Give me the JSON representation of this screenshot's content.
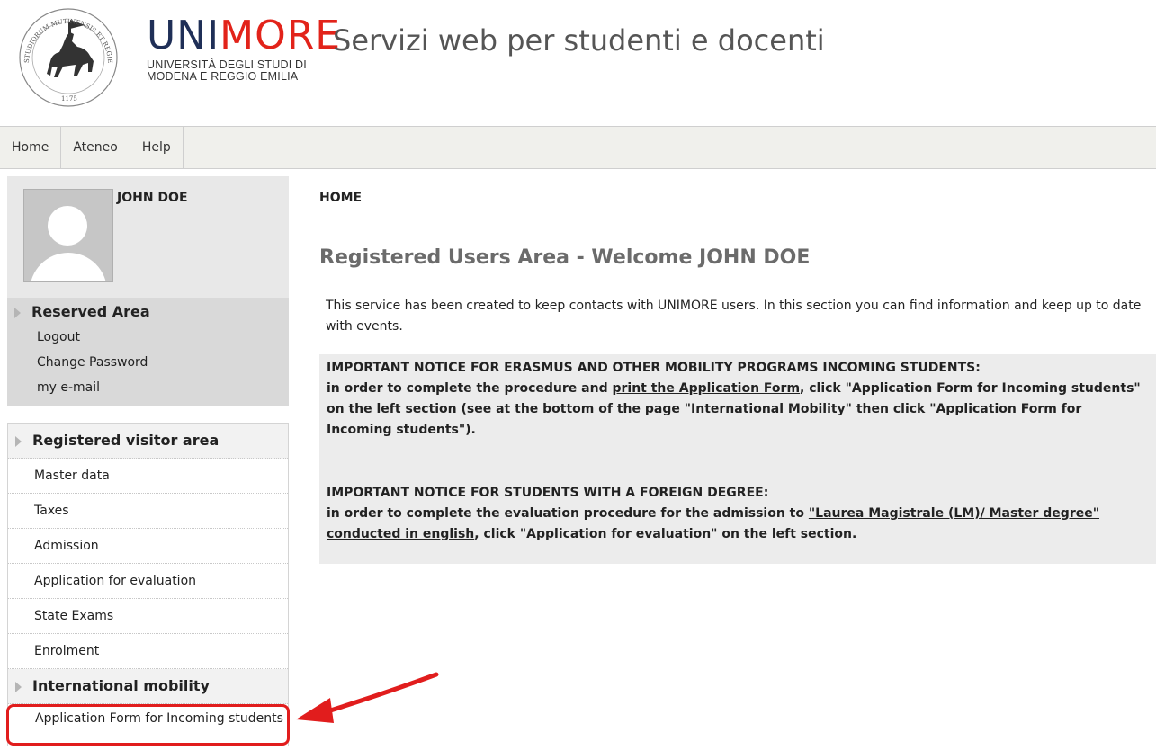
{
  "header": {
    "brand_uni": "UNI",
    "brand_more": "MORE",
    "brand_sub_line1": "UNIVERSITÀ DEGLI STUDI DI",
    "brand_sub_line2": "MODENA E REGGIO EMILIA",
    "site_title": "Servizi web per studenti e docenti",
    "seal_text": "STUDIORUM MUTINENSIS ET REGIENSIS UNIVERSITAS",
    "seal_year": "1175"
  },
  "nav": {
    "items": [
      {
        "label": "Home"
      },
      {
        "label": "Ateneo"
      },
      {
        "label": "Help"
      }
    ]
  },
  "user": {
    "name": "JOHN DOE"
  },
  "reserved": {
    "title": "Reserved Area",
    "links": [
      "Logout",
      "Change Password",
      "my e-mail"
    ]
  },
  "menu": {
    "registered_title": "Registered visitor area",
    "registered_items": [
      "Master data",
      "Taxes",
      "Admission",
      "Application for evaluation",
      "State Exams",
      "Enrolment"
    ],
    "mobility_title": "International mobility",
    "mobility_items": [
      "Application Form for Incoming students"
    ]
  },
  "main": {
    "breadcrumb": "HOME",
    "title": "Registered Users Area - Welcome JOHN DOE",
    "intro": "This service has been created to keep contacts with UNIMORE users. In this section you can find information and keep up to date with events.",
    "notice1_heading": "IMPORTANT NOTICE FOR ERASMUS AND OTHER MOBILITY PROGRAMS INCOMING STUDENTS:",
    "notice1_pre": "in order to complete the procedure and ",
    "notice1_link": "print the Application Form",
    "notice1_post": ", click \"Application Form for Incoming students\" on the left section (see at the bottom of the page \"International Mobility\" then click \"Application Form for Incoming students\").",
    "notice2_heading": "IMPORTANT NOTICE FOR STUDENTS WITH A FOREIGN DEGREE:",
    "notice2_pre": "in order to complete the evaluation procedure for the admission to ",
    "notice2_link": "\"Laurea Magistrale (LM)/ Master degree\" conducted in english",
    "notice2_post": ", click \"Application for evaluation\" on the left section."
  },
  "colors": {
    "brand_blue": "#1f2f57",
    "brand_red": "#e2231a",
    "highlight_red": "#e11d1d"
  }
}
